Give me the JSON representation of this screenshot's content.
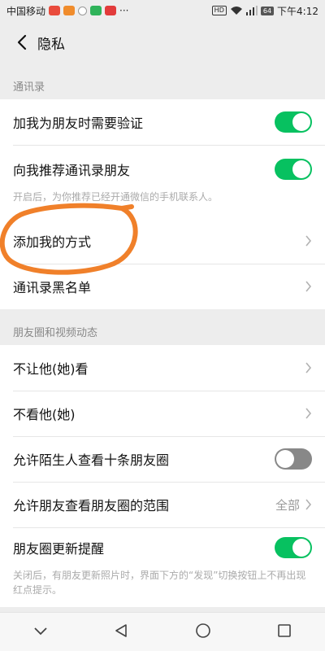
{
  "status_bar": {
    "carrier": "中国移动",
    "more": "···",
    "hd": "HD",
    "battery": "64",
    "time": "下午4:12"
  },
  "nav": {
    "title": "隐私"
  },
  "sections": {
    "contacts": {
      "header": "通讯录",
      "verify_label": "加我为朋友时需要验证",
      "verify_on": true,
      "recommend_label": "向我推荐通讯录朋友",
      "recommend_on": true,
      "recommend_hint": "开启后，为你推荐已经开通微信的手机联系人。",
      "add_me_label": "添加我的方式",
      "blacklist_label": "通讯录黑名单"
    },
    "moments": {
      "header": "朋友圈和视频动态",
      "hide_from_label": "不让他(她)看",
      "dont_view_label": "不看他(她)",
      "strangers_label": "允许陌生人查看十条朋友圈",
      "strangers_on": false,
      "range_label": "允许朋友查看朋友圈的范围",
      "range_value": "全部",
      "update_label": "朋友圈更新提醒",
      "update_on": true,
      "update_hint": "关闭后，有朋友更新照片时，界面下方的“发现”切换按钮上不再出现红点提示。"
    }
  },
  "colors": {
    "accent": "#07c160",
    "toggle_off": "#888888",
    "annotation": "#f0802a"
  },
  "icons": {
    "back": "back-chevron-icon",
    "row_chevron": "chevron-right-icon",
    "nav_down": "chevron-down-icon",
    "nav_back": "triangle-back-icon",
    "nav_home": "circle-home-icon",
    "nav_recent": "square-recent-icon"
  }
}
